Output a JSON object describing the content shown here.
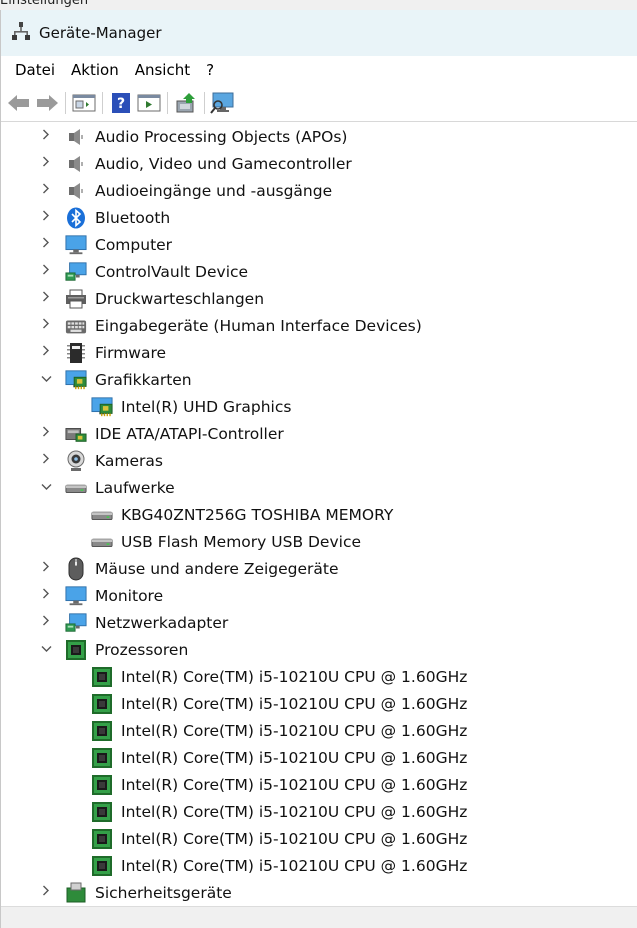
{
  "behind_window": {
    "text": "Einstellungen"
  },
  "window": {
    "title": "Geräte-Manager"
  },
  "menu": [
    "Datei",
    "Aktion",
    "Ansicht",
    "?"
  ],
  "toolbar": [
    "back-icon",
    "forward-icon",
    "properties-pane-icon",
    "help-icon",
    "run-icon",
    "update-driver-icon",
    "scan-hardware-icon"
  ],
  "tree": [
    {
      "label": "Audio Processing Objects (APOs)",
      "level": 0,
      "state": "collapsed",
      "icon": "speaker-icon"
    },
    {
      "label": "Audio, Video und Gamecontroller",
      "level": 0,
      "state": "collapsed",
      "icon": "speaker-icon"
    },
    {
      "label": "Audioeingänge und -ausgänge",
      "level": 0,
      "state": "collapsed",
      "icon": "speaker-icon"
    },
    {
      "label": "Bluetooth",
      "level": 0,
      "state": "collapsed",
      "icon": "bluetooth-icon"
    },
    {
      "label": "Computer",
      "level": 0,
      "state": "collapsed",
      "icon": "monitor-icon"
    },
    {
      "label": "ControlVault Device",
      "level": 0,
      "state": "collapsed",
      "icon": "network-monitor-icon"
    },
    {
      "label": "Druckwarteschlangen",
      "level": 0,
      "state": "collapsed",
      "icon": "printer-icon"
    },
    {
      "label": "Eingabegeräte (Human Interface Devices)",
      "level": 0,
      "state": "collapsed",
      "icon": "keyboard-icon"
    },
    {
      "label": "Firmware",
      "level": 0,
      "state": "collapsed",
      "icon": "chip-icon"
    },
    {
      "label": "Grafikkarten",
      "level": 0,
      "state": "expanded",
      "icon": "display-adapter-icon"
    },
    {
      "label": "Intel(R) UHD Graphics",
      "level": 1,
      "state": "leaf",
      "icon": "display-adapter-icon"
    },
    {
      "label": "IDE ATA/ATAPI-Controller",
      "level": 0,
      "state": "collapsed",
      "icon": "ide-controller-icon"
    },
    {
      "label": "Kameras",
      "level": 0,
      "state": "collapsed",
      "icon": "camera-icon"
    },
    {
      "label": "Laufwerke",
      "level": 0,
      "state": "expanded",
      "icon": "drive-icon"
    },
    {
      "label": "KBG40ZNT256G TOSHIBA MEMORY",
      "level": 1,
      "state": "leaf",
      "icon": "drive-icon"
    },
    {
      "label": "USB Flash Memory USB Device",
      "level": 1,
      "state": "leaf",
      "icon": "drive-icon"
    },
    {
      "label": "Mäuse und andere Zeigegeräte",
      "level": 0,
      "state": "collapsed",
      "icon": "mouse-icon"
    },
    {
      "label": "Monitore",
      "level": 0,
      "state": "collapsed",
      "icon": "monitor-icon"
    },
    {
      "label": "Netzwerkadapter",
      "level": 0,
      "state": "collapsed",
      "icon": "network-monitor-icon"
    },
    {
      "label": "Prozessoren",
      "level": 0,
      "state": "expanded",
      "icon": "processor-icon"
    },
    {
      "label": "Intel(R) Core(TM) i5-10210U CPU @ 1.60GHz",
      "level": 1,
      "state": "leaf",
      "icon": "processor-icon"
    },
    {
      "label": "Intel(R) Core(TM) i5-10210U CPU @ 1.60GHz",
      "level": 1,
      "state": "leaf",
      "icon": "processor-icon"
    },
    {
      "label": "Intel(R) Core(TM) i5-10210U CPU @ 1.60GHz",
      "level": 1,
      "state": "leaf",
      "icon": "processor-icon"
    },
    {
      "label": "Intel(R) Core(TM) i5-10210U CPU @ 1.60GHz",
      "level": 1,
      "state": "leaf",
      "icon": "processor-icon"
    },
    {
      "label": "Intel(R) Core(TM) i5-10210U CPU @ 1.60GHz",
      "level": 1,
      "state": "leaf",
      "icon": "processor-icon"
    },
    {
      "label": "Intel(R) Core(TM) i5-10210U CPU @ 1.60GHz",
      "level": 1,
      "state": "leaf",
      "icon": "processor-icon"
    },
    {
      "label": "Intel(R) Core(TM) i5-10210U CPU @ 1.60GHz",
      "level": 1,
      "state": "leaf",
      "icon": "processor-icon"
    },
    {
      "label": "Intel(R) Core(TM) i5-10210U CPU @ 1.60GHz",
      "level": 1,
      "state": "leaf",
      "icon": "processor-icon"
    },
    {
      "label": "Sicherheitsgeräte",
      "level": 0,
      "state": "collapsed",
      "icon": "security-icon"
    }
  ]
}
